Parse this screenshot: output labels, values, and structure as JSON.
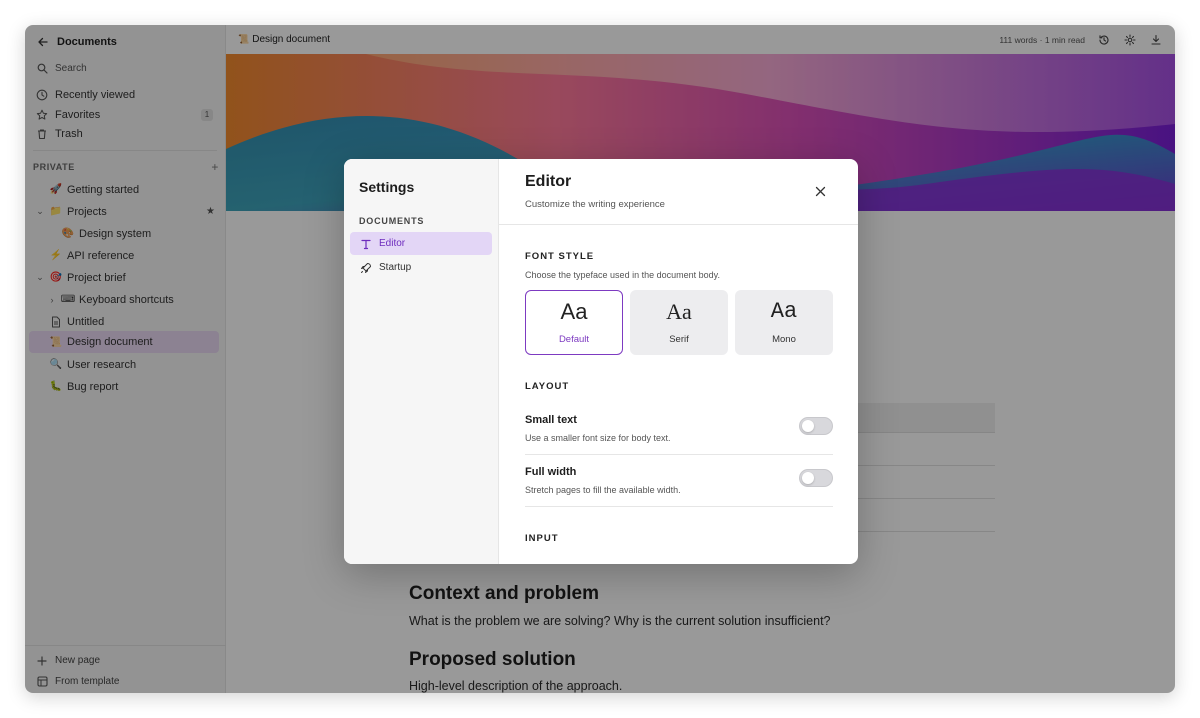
{
  "sidebar": {
    "title": "Documents",
    "search_label": "Search",
    "nav": [
      {
        "label": "Recently viewed",
        "icon": "clock-icon"
      },
      {
        "label": "Favorites",
        "icon": "star-icon",
        "badge": "1"
      },
      {
        "label": "Trash",
        "icon": "trash-icon"
      }
    ],
    "section_label": "PRIVATE",
    "pages": [
      {
        "label": "Getting started",
        "emoji": "🚀"
      },
      {
        "label": "Projects",
        "emoji": "📁"
      },
      {
        "label": "Design system",
        "emoji": "🎨"
      },
      {
        "label": "API reference",
        "emoji": "⚡"
      },
      {
        "label": "Project brief",
        "emoji": "🎯"
      },
      {
        "label": "Keyboard shortcuts",
        "emoji": "⌨"
      },
      {
        "label": "Untitled",
        "emoji": ""
      },
      {
        "label": "Design document",
        "emoji": "📜"
      },
      {
        "label": "User research",
        "emoji": "🔍"
      },
      {
        "label": "Bug report",
        "emoji": "🐛"
      }
    ],
    "footer": {
      "new_page": "New page",
      "from_template": "From template"
    }
  },
  "topbar": {
    "breadcrumb": "Design document",
    "breadcrumb_emoji": "📜",
    "meta": "111 words · 1 min read"
  },
  "document": {
    "h_context": "Context and problem",
    "p_context": "What is the problem we are solving? Why is the current solution insufficient?",
    "h_solution": "Proposed solution",
    "p_solution": "High-level description of the approach."
  },
  "modal": {
    "title": "Settings",
    "group": "DOCUMENTS",
    "nav": [
      {
        "label": "Editor",
        "icon": "text-t-icon"
      },
      {
        "label": "Startup",
        "icon": "rocket-icon"
      }
    ],
    "panel_title": "Editor",
    "panel_subtitle": "Customize the writing experience",
    "font_style": {
      "heading": "FONT STYLE",
      "description": "Choose the typeface used in the document body.",
      "options": [
        {
          "sample": "Aa",
          "label": "Default"
        },
        {
          "sample": "Aa",
          "label": "Serif"
        },
        {
          "sample": "Aa",
          "label": "Mono"
        }
      ],
      "selected": "Default"
    },
    "layout": {
      "heading": "LAYOUT",
      "small_text": {
        "title": "Small text",
        "desc": "Use a smaller font size for body text.",
        "enabled": false
      },
      "full_width": {
        "title": "Full width",
        "desc": "Stretch pages to fill the available width.",
        "enabled": false
      }
    },
    "input": {
      "heading": "INPUT"
    }
  },
  "colors": {
    "accent": "#7d3ac1",
    "active_nav_bg": "#e3d6f6",
    "overlay": "rgba(0,0,0,0.40)"
  }
}
